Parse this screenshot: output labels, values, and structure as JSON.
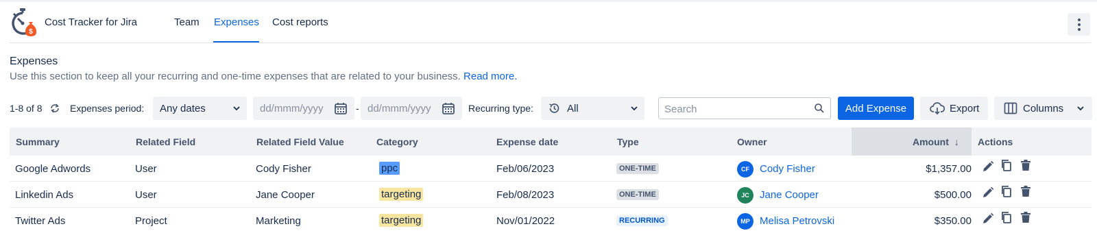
{
  "app": {
    "title": "Cost Tracker for Jira"
  },
  "nav": {
    "tabs": [
      "Team",
      "Expenses",
      "Cost reports"
    ],
    "active": "Expenses"
  },
  "section": {
    "title": "Expenses",
    "description": "Use this section to keep all your recurring and one-time expenses that are related to your business.",
    "read_more": "Read more."
  },
  "filters": {
    "count_range": "1-8",
    "count_of": "of",
    "count_total": "8",
    "period_label": "Expenses period:",
    "period_value": "Any dates",
    "date_from_placeholder": "dd/mmm/yyyy",
    "date_separator": "-",
    "date_to_placeholder": "dd/mmm/yyyy",
    "recurring_label": "Recurring type:",
    "recurring_value": "All",
    "search_placeholder": "Search"
  },
  "toolbar": {
    "add_label": "Add Expense",
    "export_label": "Export",
    "columns_label": "Columns"
  },
  "table": {
    "columns": [
      "Summary",
      "Related Field",
      "Related Field Value",
      "Category",
      "Expense date",
      "Type",
      "Owner",
      "Amount",
      "Actions"
    ],
    "sort_indicator": "↓",
    "rows": [
      {
        "summary": "Google Adwords",
        "related_field": "User",
        "related_value": "Cody Fisher",
        "category": "ppc",
        "category_color": "blue",
        "date": "Feb/06/2023",
        "type": "ONE-TIME",
        "type_color": "gray",
        "owner_initials": "CF",
        "owner_name": "Cody Fisher",
        "owner_color": "#0c66e4",
        "amount": "$1,357.00"
      },
      {
        "summary": "Linkedin Ads",
        "related_field": "User",
        "related_value": "Jane Cooper",
        "category": "targeting",
        "category_color": "yellow",
        "date": "Feb/08/2023",
        "type": "ONE-TIME",
        "type_color": "gray",
        "owner_initials": "JC",
        "owner_name": "Jane Cooper",
        "owner_color": "#1f845a",
        "amount": "$500.00"
      },
      {
        "summary": "Twitter Ads",
        "related_field": "Project",
        "related_value": "Marketing",
        "category": "targeting",
        "category_color": "yellow",
        "date": "Nov/01/2022",
        "type": "RECURRING",
        "type_color": "blue",
        "owner_initials": "MP",
        "owner_name": "Melisa Petrovski",
        "owner_color": "#0c66e4",
        "amount": "$350.00"
      }
    ]
  },
  "icons": {
    "logo": "stopwatch-money-bag-icon",
    "more": "more-vertical-icon",
    "refresh": "refresh-icon",
    "calendar": "calendar-icon",
    "history": "history-icon",
    "search": "search-icon",
    "export": "cloud-download-icon",
    "columns": "columns-icon",
    "edit": "pencil-icon",
    "copy": "copy-icon",
    "delete": "trash-icon"
  },
  "colors": {
    "accent": "#0c66e4",
    "logo_accent": "#f15a24"
  }
}
